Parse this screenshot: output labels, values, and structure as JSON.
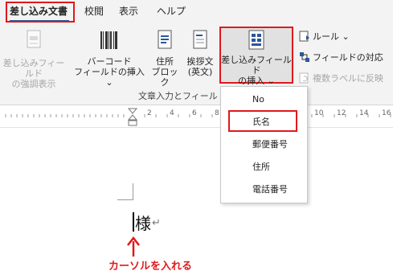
{
  "tabs": [
    {
      "label": "差し込み文書",
      "active": true
    },
    {
      "label": "校閲"
    },
    {
      "label": "表示"
    },
    {
      "label": "ヘルプ"
    }
  ],
  "ribbon": {
    "highlight_label": {
      "line1": "差し込みフィールド",
      "line2": "の強調表示",
      "disabled": true
    },
    "barcode": {
      "line1": "バーコード",
      "line2": "フィールドの挿入 ⌄"
    },
    "address_block": {
      "line1": "住所",
      "line2": "ブロック"
    },
    "greeting": {
      "line1": "挨拶文",
      "line2": "(英文)"
    },
    "insert_merge_field": {
      "line1": "差し込みフィールド",
      "line2": "の挿入 ⌄"
    },
    "rules": "ルール ⌄",
    "match_fields": "フィールドの対応",
    "duplicate_labels": {
      "label": "複数ラベルに反映",
      "disabled": true
    },
    "group_label": "文章入力とフィールド"
  },
  "ruler": {
    "numbers": [
      "2",
      "4",
      "6",
      "8",
      "10",
      "12",
      "14",
      "16"
    ]
  },
  "dropdown": {
    "items": [
      "No",
      "氏名",
      "郵便番号",
      "住所",
      "電話番号"
    ],
    "highlighted": "氏名"
  },
  "document": {
    "text": "様",
    "para_mark": "↵"
  },
  "annotation": {
    "text": "カーソルを入れる",
    "color": "#e0191b"
  },
  "colors": {
    "accent": "#2b579a",
    "highlight": "#e0191b",
    "ribbon_bg": "#f3f3f3"
  }
}
